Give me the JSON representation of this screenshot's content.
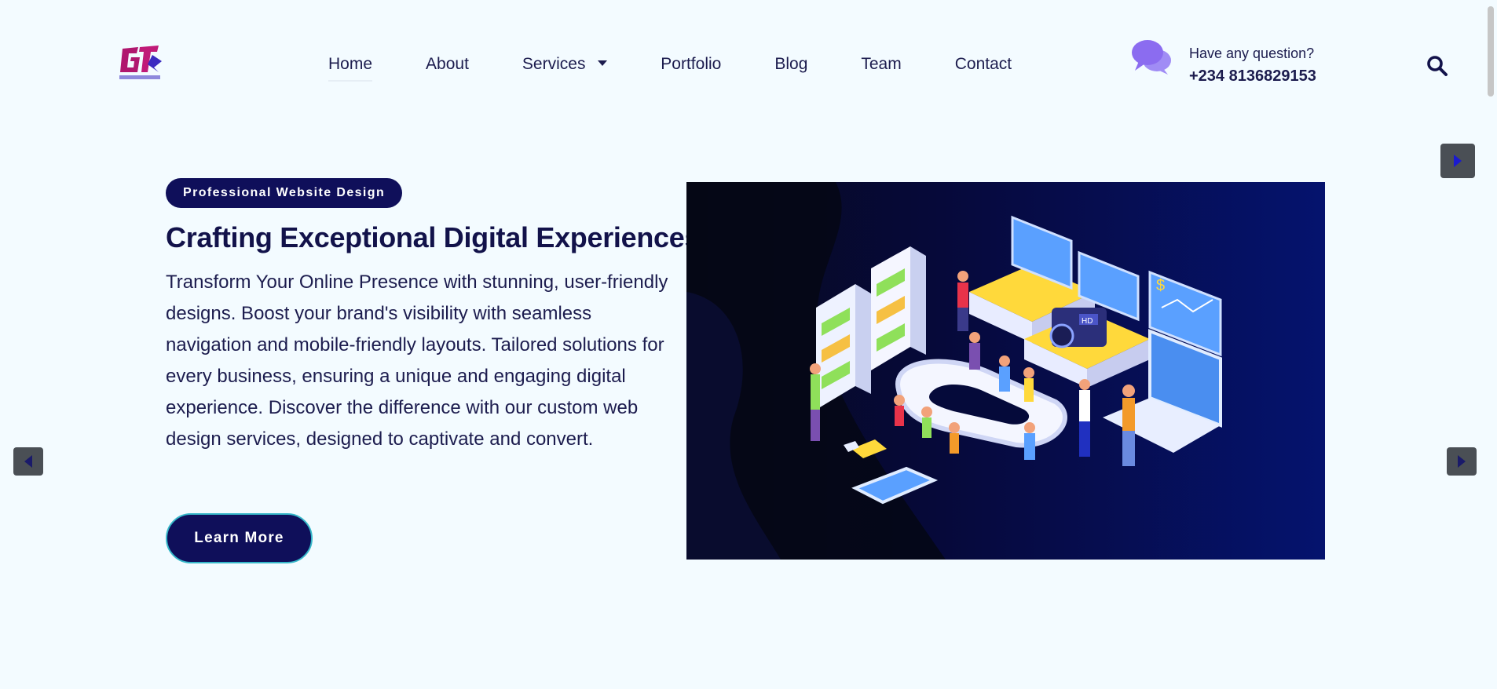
{
  "nav": {
    "items": [
      {
        "label": "Home",
        "active": true
      },
      {
        "label": "About"
      },
      {
        "label": "Services",
        "has_dropdown": true
      },
      {
        "label": "Portfolio"
      },
      {
        "label": "Blog"
      },
      {
        "label": "Team"
      },
      {
        "label": "Contact"
      }
    ]
  },
  "contact": {
    "question": "Have any question?",
    "phone": "+234 8136829153",
    "icon": "chat-bubbles-icon"
  },
  "hero": {
    "badge": "Professional Website Design",
    "title": "Crafting Exceptional Digital Experiences",
    "description": "Transform Your Online Presence with stunning, user-friendly designs. Boost your brand's visibility with seamless navigation and mobile-friendly layouts. Tailored solutions for every business, ensuring a unique and engaging digital experience. Discover the difference with our custom web design services, designed to captivate and convert.",
    "button_label": "Learn More",
    "illustration_badge": "HD",
    "illustration_currency": "$"
  },
  "colors": {
    "brand_navy": "#0f0f5a",
    "background": "#f3fbff",
    "accent_purple": "#8b6cf0",
    "button_border": "#36b7c9"
  }
}
